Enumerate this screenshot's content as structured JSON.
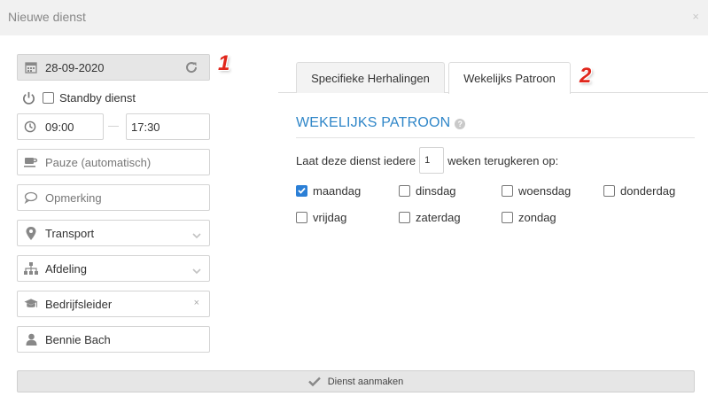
{
  "dialog": {
    "title": "Nieuwe dienst",
    "close_glyph": "×"
  },
  "annotations": {
    "one": "1",
    "two": "2",
    "color": "#e0261b"
  },
  "left": {
    "date": {
      "icon": "calendar-icon",
      "value": "28-09-2020",
      "action_icon": "refresh-icon"
    },
    "standby": {
      "icon": "power-icon",
      "label": "Standby dienst",
      "checked": false
    },
    "time": {
      "icon": "clock-icon",
      "start": "09:00",
      "end": "17:30"
    },
    "pause": {
      "icon": "coffee-icon",
      "placeholder": "Pauze (automatisch)"
    },
    "remark": {
      "icon": "comment-icon",
      "placeholder": "Opmerking"
    },
    "transport": {
      "icon": "map-marker-icon",
      "value": "Transport"
    },
    "department": {
      "icon": "sitemap-icon",
      "value": "Afdeling"
    },
    "role": {
      "icon": "graduation-cap-icon",
      "value": "Bedrijfsleider",
      "clear_glyph": "×"
    },
    "employee": {
      "icon": "user-icon",
      "value": "Bennie Bach"
    }
  },
  "tabs": [
    {
      "label": "Specifieke Herhalingen",
      "active": false
    },
    {
      "label": "Wekelijks Patroon",
      "active": true
    }
  ],
  "weekly": {
    "title": "WEKELIJKS PATROON",
    "help_glyph": "?",
    "repeat_before": "Laat deze dienst iedere",
    "repeat_value": "1",
    "repeat_after": "weken terugkeren op:",
    "days": [
      {
        "label": "maandag",
        "checked": true
      },
      {
        "label": "dinsdag",
        "checked": false
      },
      {
        "label": "woensdag",
        "checked": false
      },
      {
        "label": "donderdag",
        "checked": false
      },
      {
        "label": "vrijdag",
        "checked": false
      },
      {
        "label": "zaterdag",
        "checked": false
      },
      {
        "label": "zondag",
        "checked": false
      }
    ]
  },
  "submit": {
    "label": "Dienst aanmaken",
    "icon": "check-icon"
  },
  "colors": {
    "accent": "#2f86c8",
    "checkbox_checked": "#2b7fd6",
    "titlebar_bg": "#f1f1f1"
  }
}
